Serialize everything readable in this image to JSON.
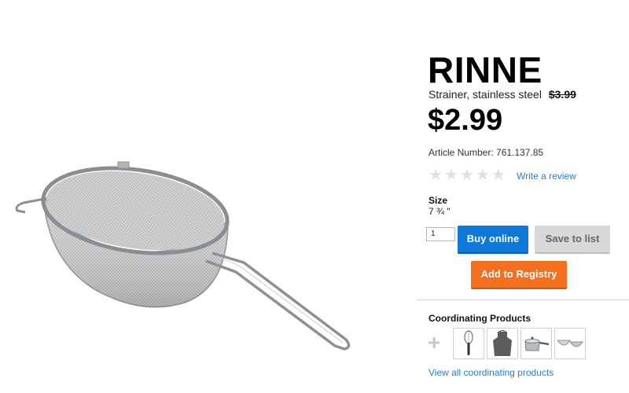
{
  "product": {
    "name": "RINNE",
    "description": "Strainer, stainless steel",
    "old_price": "$3.99",
    "price": "$2.99",
    "article_number": "Article Number: 761.137.85",
    "rating_stars": 0,
    "review_link": "Write a review",
    "size_label": "Size",
    "size_value": "7 ¾ \""
  },
  "purchase": {
    "quantity": "1",
    "buy_label": "Buy online",
    "save_label": "Save to list",
    "registry_label": "Add to Registry"
  },
  "coordinating": {
    "heading": "Coordinating Products",
    "plus_symbol": "+",
    "items": [
      "whisk-icon",
      "apron-icon",
      "saucepan-icon",
      "bowls-icon"
    ],
    "view_all": "View all coordinating products"
  },
  "colors": {
    "buy": "#0e77d8",
    "save": "#d8d8d8",
    "registry": "#f4701f",
    "link": "#2a7fcf"
  }
}
